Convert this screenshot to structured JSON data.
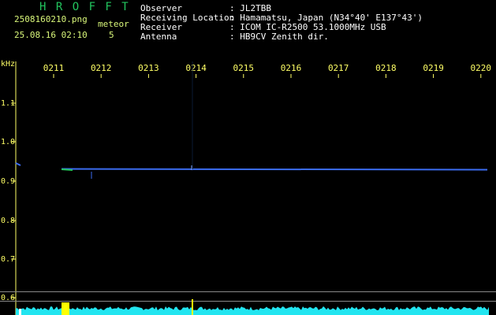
{
  "header": {
    "brand": "H R O F F T",
    "filename": "2508160210.png",
    "datetime": "25.08.16 02:10",
    "meteor_label": "meteor",
    "meteor_count": "5"
  },
  "station": {
    "observer_label": "Observer",
    "observer_value": ": JL2TBB",
    "location_label": "Receiving Location",
    "location_value": ": Hamamatsu, Japan (N34°40' E137°43')",
    "receiver_label": "Receiver",
    "receiver_value": ": ICOM IC-R2500 53.1000MHz USB",
    "antenna_label": "Antenna",
    "antenna_value": ": HB9CV Zenith dir."
  },
  "axis": {
    "y_unit": "kHz",
    "y_ticks": [
      "1.1",
      "1.0",
      "0.9",
      "0.8",
      "0.7",
      "0.6"
    ],
    "x_ticks": [
      "0211",
      "0212",
      "0213",
      "0214",
      "0215",
      "0216",
      "0217",
      "0218",
      "0219",
      "0220"
    ]
  },
  "colors": {
    "trace": "#3b6cf0",
    "tick": "#ffff66",
    "signal": "#22e5f0",
    "burst": "#ffff00",
    "grid": "#888888"
  }
}
